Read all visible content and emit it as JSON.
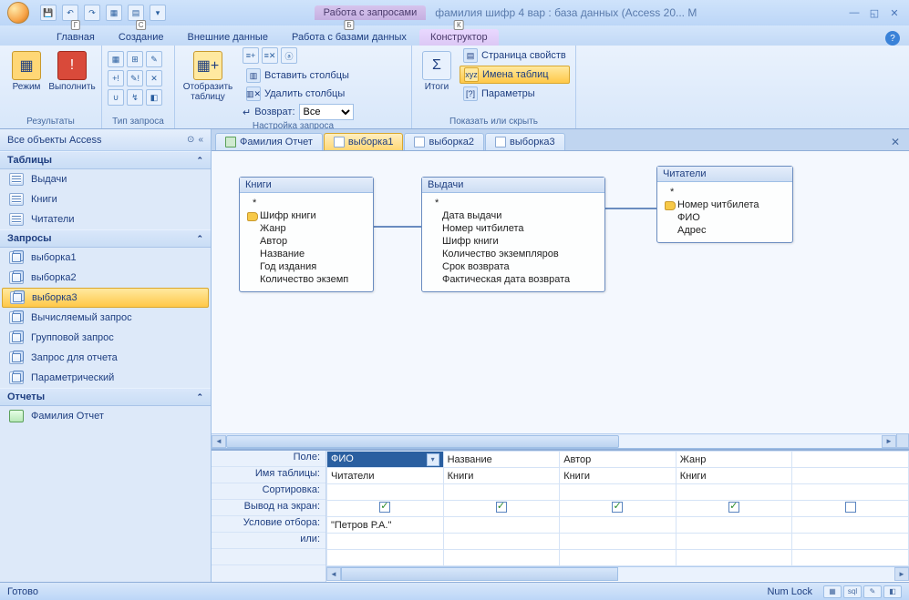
{
  "title": {
    "contextual": "Работа с запросами",
    "window": "фамилия шифр 4 вар : база данных (Access 20... M"
  },
  "tabs": {
    "home": "Главная",
    "create": "Создание",
    "external": "Внешние данные",
    "dbtools": "Работа с базами данных",
    "designer": "Конструктор"
  },
  "ribbon": {
    "results": {
      "view": "Режим",
      "run": "Выполнить",
      "label": "Результаты"
    },
    "qtype": {
      "label": "Тип запроса"
    },
    "setup": {
      "showtable": "Отобразить таблицу",
      "insertcols": "Вставить столбцы",
      "deletecols": "Удалить столбцы",
      "return": "Возврат:",
      "return_val": "Все",
      "label": "Настройка запроса"
    },
    "totals": {
      "btn": "Итоги"
    },
    "showhide": {
      "propsheet": "Страница свойств",
      "tablenames": "Имена таблиц",
      "params": "Параметры",
      "label": "Показать или скрыть"
    }
  },
  "nav": {
    "header": "Все объекты Access",
    "s_tables": "Таблицы",
    "tables": [
      "Выдачи",
      "Книги",
      "Читатели"
    ],
    "s_queries": "Запросы",
    "queries": [
      "выборка1",
      "выборка2",
      "выборка3",
      "Вычисляемый запрос",
      "Групповой запрос",
      "Запрос для отчета",
      "Параметрический"
    ],
    "s_reports": "Отчеты",
    "reports": [
      "Фамилия Отчет"
    ]
  },
  "doctabs": {
    "t0": "Фамилия Отчет",
    "t1": "выборка1",
    "t2": "выборка2",
    "t3": "выборка3"
  },
  "diagram": {
    "books": {
      "title": "Книги",
      "fields": [
        "*",
        "Шифр книги",
        "Жанр",
        "Автор",
        "Название",
        "Год издания",
        "Количество экземп"
      ],
      "key": 1
    },
    "issues": {
      "title": "Выдачи",
      "fields": [
        "*",
        "Дата выдачи",
        "Номер читбилета",
        "Шифр книги",
        "Количество экземпляров",
        "Срок возврата",
        "Фактическая дата возврата"
      ]
    },
    "readers": {
      "title": "Читатели",
      "fields": [
        "*",
        "Номер читбилета",
        "ФИО",
        "Адрес"
      ],
      "key": 1
    }
  },
  "qbe": {
    "rows": [
      "Поле:",
      "Имя таблицы:",
      "Сортировка:",
      "Вывод на экран:",
      "Условие отбора:",
      "или:"
    ],
    "cols": [
      {
        "field": "ФИО",
        "table": "Читатели",
        "show": true,
        "criteria": "\"Петров Р.А.\""
      },
      {
        "field": "Название",
        "table": "Книги",
        "show": true,
        "criteria": ""
      },
      {
        "field": "Автор",
        "table": "Книги",
        "show": true,
        "criteria": ""
      },
      {
        "field": "Жанр",
        "table": "Книги",
        "show": true,
        "criteria": ""
      },
      {
        "field": "",
        "table": "",
        "show": false,
        "criteria": ""
      }
    ]
  },
  "status": {
    "ready": "Готово",
    "numlock": "Num Lock"
  }
}
